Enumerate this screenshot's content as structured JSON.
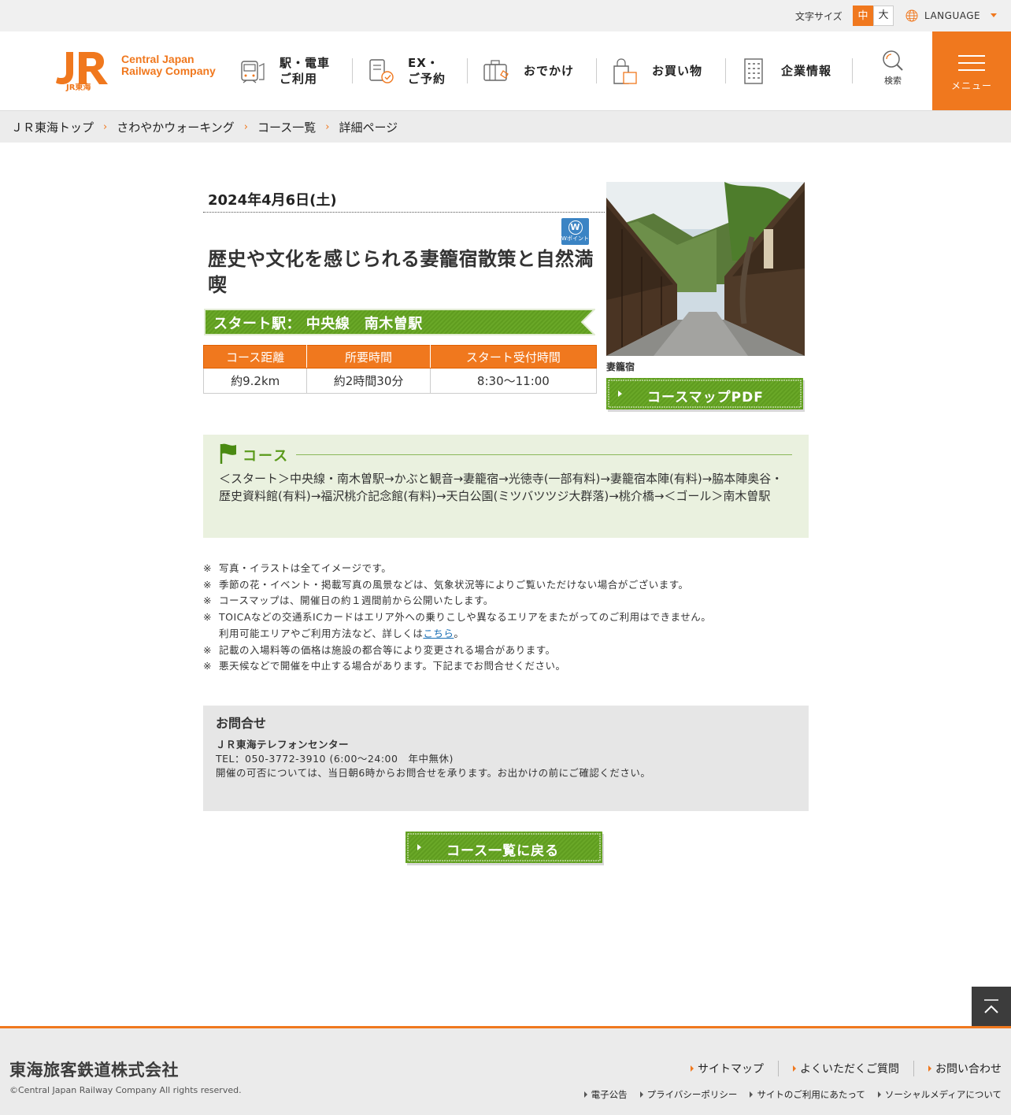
{
  "utility": {
    "font_size_label": "文字サイズ",
    "font_size_medium": "中",
    "font_size_large": "大",
    "language": "LANGUAGE"
  },
  "header": {
    "logo_mark": "JR",
    "logo_sub": "JR東海",
    "logo_line1": "Central Japan",
    "logo_line2": "Railway Company",
    "nav": [
      {
        "line1": "駅・電車",
        "line2": "ご利用",
        "icon": "train-icon"
      },
      {
        "line1": "EX・",
        "line2": "ご予約",
        "icon": "reservation-icon"
      },
      {
        "line1": "おでかけ",
        "line2": "",
        "icon": "luggage-icon"
      },
      {
        "line1": "お買い物",
        "line2": "",
        "icon": "shopping-bag-icon"
      },
      {
        "line1": "企業情報",
        "line2": "",
        "icon": "building-icon"
      }
    ],
    "search_label": "検索",
    "menu_label": "メニュー"
  },
  "breadcrumb": [
    "ＪＲ東海トップ",
    "さわやかウォーキング",
    "コース一覧",
    "詳細ページ"
  ],
  "event": {
    "date": "2024年4月6日(土)",
    "badge_letter": "W",
    "badge_text": "Wポイント",
    "title": "歴史や文化を感じられる妻籠宿散策と自然満喫",
    "start_station": "スタート駅： 中央線　南木曽駅",
    "table_headers": [
      "コース距離",
      "所要時間",
      "スタート受付時間"
    ],
    "table_values": [
      "約9.2km",
      "約2時間30分",
      "8:30～11:00"
    ],
    "photo_caption": "妻籠宿",
    "pdf_button": "コースマップPDF"
  },
  "course": {
    "heading": "コース",
    "route": "＜スタート＞中央線・南木曽駅→かぶと観音→妻籠宿→光徳寺(一部有料)→妻籠宿本陣(有料)→脇本陣奥谷・歴史資料館(有料)→福沢桃介記念館(有料)→天白公園(ミツバツツジ大群落)→桃介橋→＜ゴール＞南木曽駅"
  },
  "notes": {
    "mark": "※",
    "n1": "写真・イラストは全てイメージです。",
    "n2": "季節の花・イベント・掲載写真の風景などは、気象状況等によりご覧いただけない場合がございます。",
    "n3": "コースマップは、開催日の約１週間前から公開いたします。",
    "n4": "TOICAなどの交通系ICカードはエリア外への乗りこしや異なるエリアをまたがってのご利用はできません。",
    "n4b_pre": "利用可能エリアやご利用方法など、詳しくは",
    "n4b_link": "こちら",
    "n4b_post": "。",
    "n5": "記載の入場料等の価格は施設の都合等により変更される場合があります。",
    "n6": "悪天候などで開催を中止する場合があります。下記までお問合せください。"
  },
  "contact": {
    "heading": "お問合せ",
    "center": "ＪＲ東海テレフォンセンター",
    "tel": "TEL：050-3772-3910 (6:00～24:00　年中無休)",
    "note": "開催の可否については、当日朝6時からお問合せを承ります。お出かけの前にご確認ください。"
  },
  "back_button": "コース一覧に戻る",
  "footer": {
    "company": "東海旅客鉄道株式会社",
    "copyright": "©Central Japan Railway Company All rights reserved.",
    "links": [
      "サイトマップ",
      "よくいただくご質問",
      "お問い合わせ"
    ],
    "sub_links": [
      "電子公告",
      "プライバシーポリシー",
      "サイトのご利用にあたって",
      "ソーシャルメディアについて"
    ]
  },
  "colors": {
    "accent": "#f0781e",
    "green": "#5a9a1a",
    "course_bg": "#eaf1df",
    "contact_bg": "#e6e6e6"
  }
}
